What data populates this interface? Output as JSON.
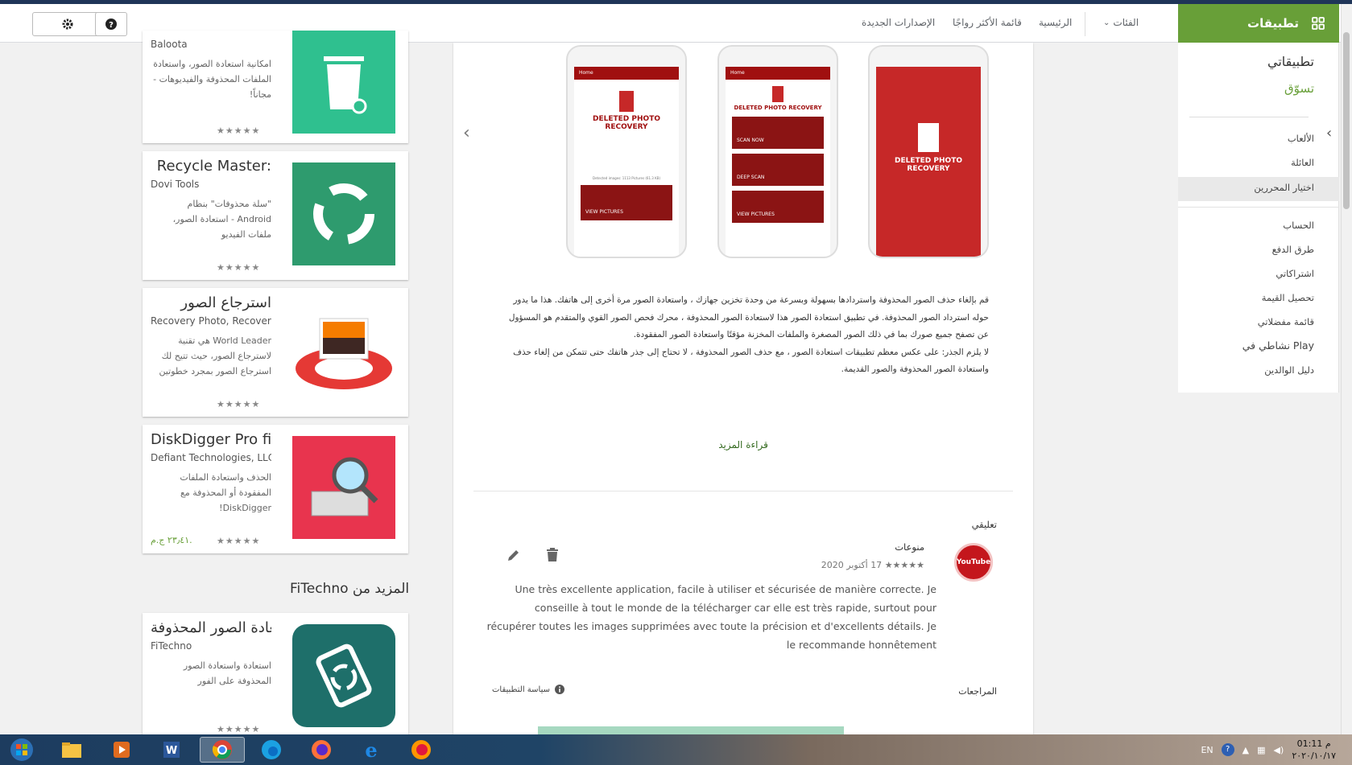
{
  "header": {
    "apps_label": "تطبيقات",
    "nav": {
      "categories": "الفئات",
      "home": "الرئيسية",
      "top_charts": "قائمة الأكثر رواجًا",
      "new_releases": "الإصدارات الجديدة"
    }
  },
  "sidebar": {
    "my_apps": "تطبيقاتي",
    "shop": "تسوّق",
    "games": "الألعاب",
    "family": "العائلة",
    "editors_choice": "اختيار المحررين",
    "account": "الحساب",
    "payment_methods": "طرق الدفع",
    "subscriptions": "اشتراكاتي",
    "redeem": "تحصيل القيمة",
    "wishlist": "قائمة مفضلاتي",
    "play_activity": "نشاطي في Play",
    "parent_guide": "دليل الوالدين"
  },
  "cards": [
    {
      "title": "",
      "developer": "Baloota",
      "desc": "امكانية استعادة الصور، واستعادة الملفات المحذوفة والفيديوهات - مجاناً!",
      "stars": "★★★★★",
      "price": ""
    },
    {
      "title": "Recycle Master:",
      "developer": "Dovi Tools",
      "desc": "\"سلة محذوفات\" بنظام Android - استعادة الصور، ملفات الفيديو",
      "stars": "★★★★★",
      "price": ""
    },
    {
      "title": "استرجاع الصور",
      "developer": "Recovery Photo, Recover",
      "desc": "World Leader هي تقنية لاسترجاع الصور، حيث تتيح لك استرجاع الصور بمجرد خطوتين",
      "stars": "★★★★★",
      "price": ""
    },
    {
      "title": "DiskDigger Pro fi",
      "developer": "Defiant Technologies, LLC",
      "desc": "الحذف واستعادة الملفات المفقودة أو المحذوفة مع DiskDigger!",
      "stars": "★★★★★",
      "price": "٢٣٫٤١ ج.م."
    },
    {
      "title": "استعادة الصور المحذوفة",
      "developer": "FiTechno",
      "desc": "استعادة واستعادة الصور المحذوفة على الفور",
      "stars": "★★★★★",
      "price": ""
    }
  ],
  "more_from": "المزيد من FiTechno",
  "screenshots": {
    "appbar_title": "Home",
    "app_name": "DELETED PHOTO RECOVERY",
    "scan_now": "SCAN NOW",
    "deep_scan": "DEEP SCAN",
    "view_pictures": "VIEW PICTURES",
    "detected": "Detected images: 1113 Pictures (61.3 KB)"
  },
  "description": {
    "p1": "قم بإلغاء حذف الصور المحذوفة واستردادها بسهولة وبسرعة من وحدة تخزين جهازك ، واستعادة الصور مرة أخرى إلى هاتفك. هذا ما يدور حوله استرداد الصور المحذوفة. في تطبيق استعادة الصور هذا لاستعادة الصور المحذوفة ، محرك فحص الصور القوي والمتقدم هو المسؤول عن تصفح جميع صورك بما في ذلك الصور المصغرة والملفات المخزنة مؤقتًا واستعادة الصور المفقودة.",
    "p2": "لا يلزم الجذر: على عكس معظم تطبيقات استعادة الصور ، مع حذف الصور المحذوفة ، لا تحتاج إلى جذر هاتفك حتى تتمكن من إلغاء حذف واستعادة الصور المحذوفة والصور القديمة."
  },
  "read_more": "قراءة المزيد",
  "review": {
    "heading": "تعليقي",
    "reviewer": "منوعات",
    "stars": "★★★★★",
    "date": "17 أكتوبر 2020",
    "avatar_text": "YouTube",
    "text": "Une très excellente application, facile à utiliser et sécurisée de manière correcte. Je conseille à tout le monde de la télécharger car elle est très rapide, surtout pour récupérer toutes les images supprimées avec toute la précision et d'excellents détails. Je le recommande honnêtement"
  },
  "reviews_label": "المراجعات",
  "policy_label": "سياسة التطبيقات",
  "taskbar": {
    "lang": "EN",
    "time": "01:11 م",
    "date": "٢٠٢٠/١٠/١٧"
  },
  "colors": {
    "accent": "#689f38",
    "taskbar": "#1f4466"
  }
}
